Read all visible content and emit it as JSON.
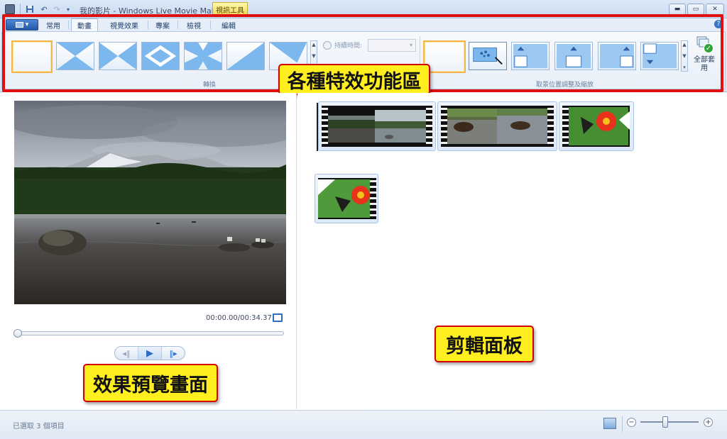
{
  "titlebar": {
    "title": "我的影片 - Windows Live Movie Maker",
    "context_tab": "視訊工具",
    "minimize": "▬",
    "maximize": "▭",
    "close": "✕"
  },
  "ribbon": {
    "tabs": [
      "常用",
      "動畫",
      "視覺效果",
      "專案",
      "檢視",
      "編輯"
    ],
    "active_tab": "動畫",
    "help": "?",
    "duration_label": "持續時間:",
    "transitions_group_label": "轉換",
    "panzoom_group_label": "取景位置調整及縮放",
    "apply_all_label": "全部套用"
  },
  "callouts": {
    "ribbon": "各種特效功能區",
    "preview": "效果預覽畫面",
    "storyboard": "剪輯面板"
  },
  "preview": {
    "timecode": "00:00.00/00:34.37",
    "progress_fraction": 0.0
  },
  "statusbar": {
    "text": "已選取 3 個項目",
    "zoom_minus": "−",
    "zoom_plus": "+"
  },
  "colors": {
    "accent": "#2c6cc4",
    "callout_fill": "#ffef1f",
    "callout_border": "#d40000",
    "selection": "#f2b64c"
  }
}
